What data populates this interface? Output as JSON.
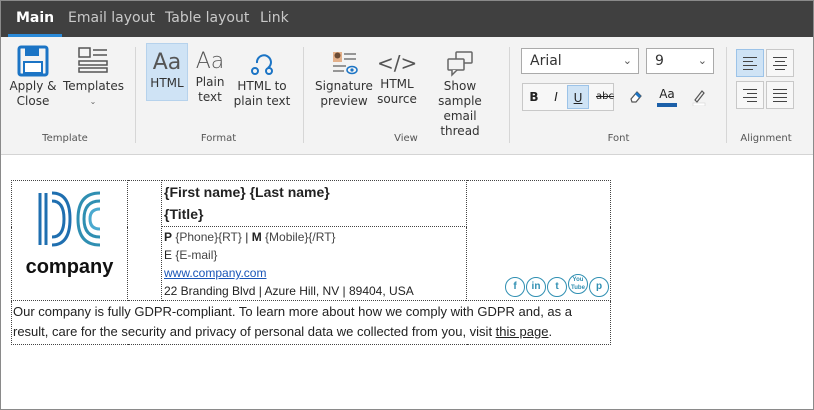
{
  "tabs": [
    {
      "label": "Main",
      "active": true
    },
    {
      "label": "Email layout"
    },
    {
      "label": "Table layout"
    },
    {
      "label": "Link"
    }
  ],
  "ribbon": {
    "template_group": {
      "label": "Template",
      "apply_close": "Apply &\nClose",
      "templates": "Templates"
    },
    "format_group": {
      "label": "Format",
      "html": "HTML",
      "plain_text": "Plain\ntext",
      "html_to_plain": "HTML to\nplain text"
    },
    "view_group": {
      "label": "View",
      "signature_preview": "Signature\npreview",
      "html_source": "HTML\nsource",
      "sample_thread": "Show sample\nemail thread"
    },
    "font_group": {
      "label": "Font",
      "font_name": "Arial",
      "font_size": "9",
      "bold": "B",
      "italic": "I",
      "underline": "U",
      "strike": "abc",
      "font_color": "Aa"
    },
    "alignment_group": {
      "label": "Alignment"
    }
  },
  "signature": {
    "logo_text": "company",
    "name_line": "{First name} {Last name}",
    "title_line": "{Title}",
    "phone_prefix": "P",
    "phone_value": "{Phone}{RT}",
    "mobile_sep": "|",
    "mobile_prefix": "M",
    "mobile_value": "{Mobile}{/RT}",
    "email_prefix": "E",
    "email_value": "{E-mail}",
    "website": "www.company.com",
    "address": "22 Branding Blvd | Azure Hill, NV | 89404, USA",
    "social": [
      "f",
      "in",
      "t",
      "You\nTube",
      "p"
    ],
    "gdpr_text": "Our company is fully GDPR-compliant. To learn more about how we comply with GDPR and, as a result, care for the security and privacy of personal data we collected from you, visit ",
    "gdpr_link": "this page",
    "gdpr_end": "."
  },
  "colors": {
    "accent": "#2b8ad8",
    "logo": "#1f6fb0",
    "social": "#2f8fb2"
  }
}
